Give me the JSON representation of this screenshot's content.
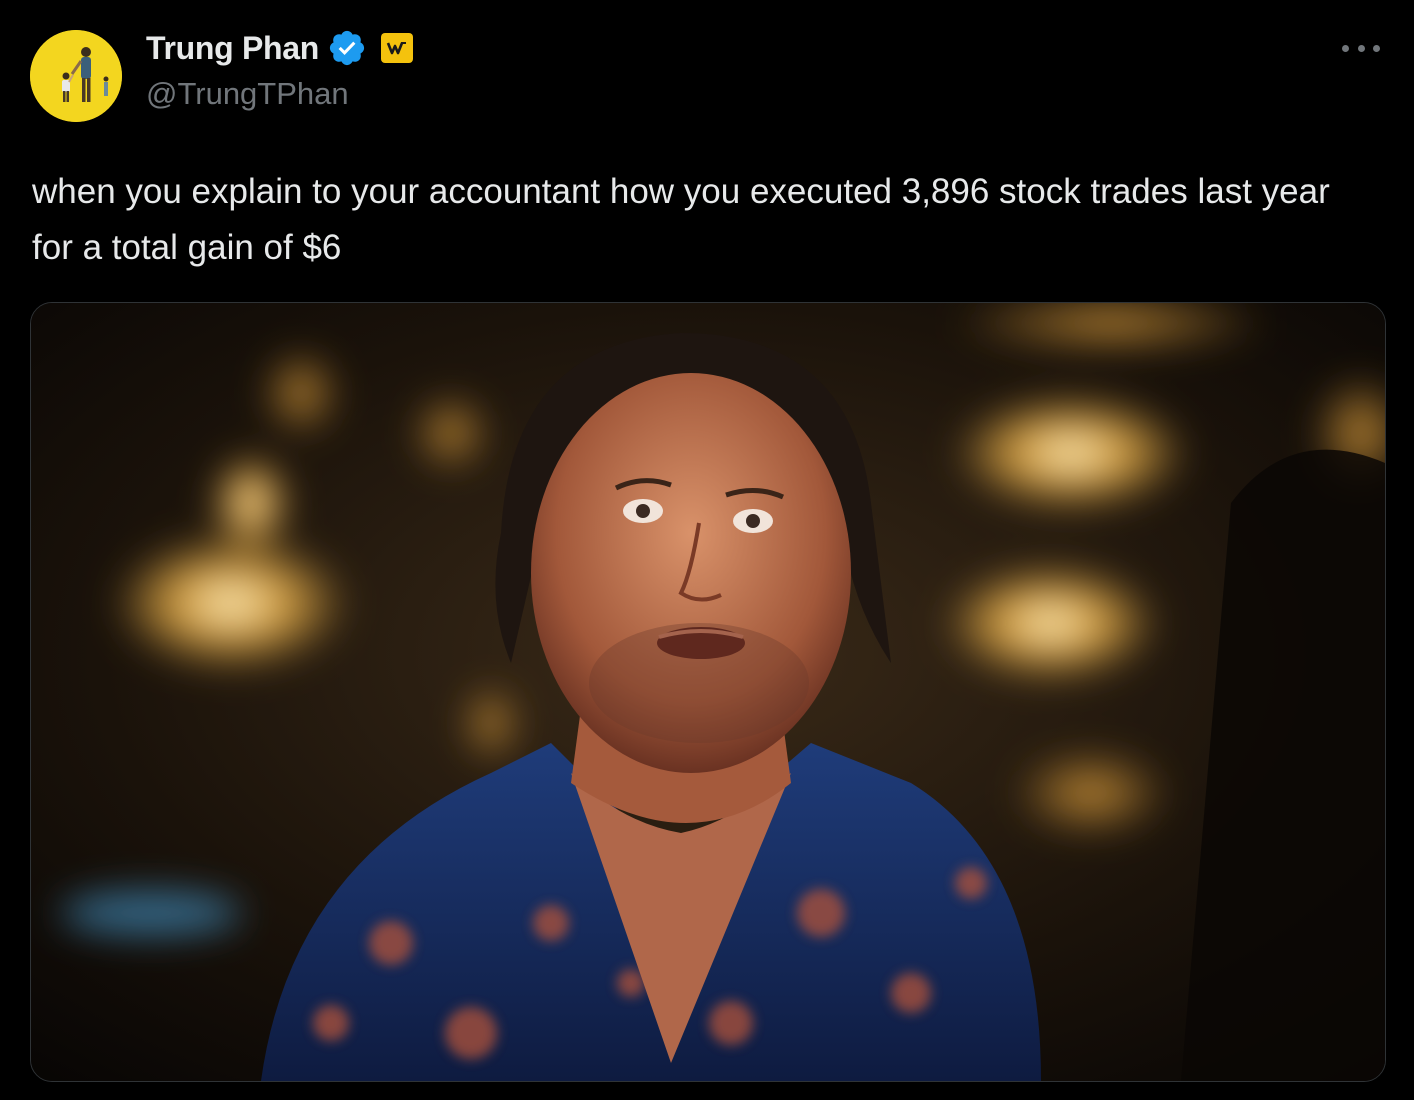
{
  "tweet": {
    "author": {
      "display_name": "Trung Phan",
      "handle": "@TrungTPhan",
      "verified": true,
      "avatar_icon": "person-with-child-avatar",
      "badge_icon": "w-affiliate-badge",
      "avatar_bg": "#f3d61f"
    },
    "text": "when you explain to your accountant how you executed 3,896 stock trades last year for a total gain of $6",
    "more_icon": "more-horizontal-icon",
    "media": {
      "type": "photo",
      "description_icon": "shocked-man-in-patterned-shirt-photo"
    }
  },
  "colors": {
    "background": "#000000",
    "text_primary": "#e7e9ea",
    "text_secondary": "#71767b",
    "verified_blue": "#1d9bf0",
    "badge_yellow": "#f4c20d"
  }
}
